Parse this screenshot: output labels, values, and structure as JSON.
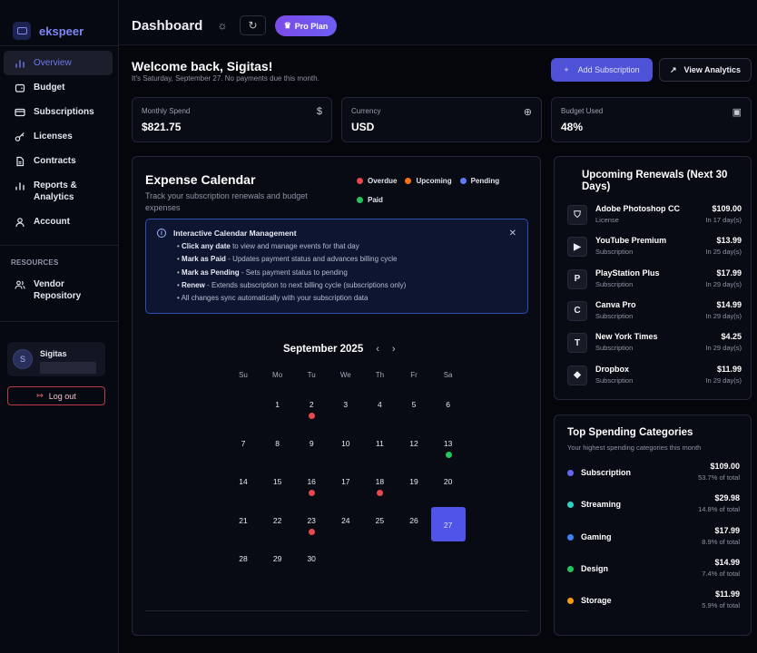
{
  "app": {
    "brand": "ekspeer"
  },
  "sidebar": {
    "items": [
      {
        "label": "Overview"
      },
      {
        "label": "Budget"
      },
      {
        "label": "Subscriptions"
      },
      {
        "label": "Licenses"
      },
      {
        "label": "Contracts"
      },
      {
        "label": "Reports &\nAnalytics"
      },
      {
        "label": "Account"
      }
    ],
    "resources_title": "RESOURCES",
    "resources": [
      {
        "label": "Vendor\nRepository"
      }
    ],
    "user": {
      "initial": "S",
      "name": "Sigitas"
    },
    "logout_label": "Log out"
  },
  "topbar": {
    "title": "Dashboard",
    "pro_label": "Pro Plan"
  },
  "welcome": {
    "title": "Welcome back, Sigitas!",
    "subtitle": "It's Saturday, September 27. No payments due this month.",
    "add_label": "Add Subscription",
    "analytics_label": "View Analytics"
  },
  "stats": [
    {
      "label": "Monthly Spend",
      "value": "$821.75",
      "icon": "dollar-icon"
    },
    {
      "label": "Currency",
      "value": "USD",
      "icon": "globe-icon"
    },
    {
      "label": "Budget Used",
      "value": "48%",
      "icon": "wallet-icon"
    }
  ],
  "calendar": {
    "title": "Expense Calendar",
    "subtitle": "Track your subscription renewals and budget expenses",
    "legend": [
      {
        "label": "Overdue",
        "color": "#e5484d"
      },
      {
        "label": "Upcoming",
        "color": "#f97316"
      },
      {
        "label": "Pending",
        "color": "#5b7cf6"
      },
      {
        "label": "Paid",
        "color": "#22c55e"
      }
    ],
    "info": {
      "title": "Interactive Calendar Management",
      "lines": [
        {
          "bold": "Click any date",
          "text": " to view and manage events for that day"
        },
        {
          "bold": "Mark as Paid",
          "text": " - Updates payment status and advances billing cycle"
        },
        {
          "bold": "Mark as Pending",
          "text": " - Sets payment status to pending"
        },
        {
          "bold": "Renew",
          "text": " - Extends subscription to next billing cycle (subscriptions only)"
        },
        {
          "bold": "",
          "text": "All changes sync automatically with your subscription data"
        }
      ]
    },
    "month_label": "September 2025",
    "weekdays": [
      "Su",
      "Mo",
      "Tu",
      "We",
      "Th",
      "Fr",
      "Sa"
    ],
    "first_weekday": 1,
    "days_in_month": 30,
    "today": 27,
    "events": {
      "2": "#e5484d",
      "13": "#22c55e",
      "16": "#e5484d",
      "18": "#e5484d",
      "23": "#e5484d"
    }
  },
  "renewals": {
    "title": "Upcoming Renewals (Next 30 Days)",
    "items": [
      {
        "name": "Adobe Photoshop CC",
        "type": "License",
        "price": "$109.00",
        "due": "In 17 day(s)",
        "icon": "shield-icon",
        "glyph": "⛉"
      },
      {
        "name": "YouTube Premium",
        "type": "Subscription",
        "price": "$13.99",
        "due": "In 25 day(s)",
        "icon": "youtube-icon",
        "glyph": "▶"
      },
      {
        "name": "PlayStation Plus",
        "type": "Subscription",
        "price": "$17.99",
        "due": "In 29 day(s)",
        "icon": "playstation-icon",
        "glyph": "P"
      },
      {
        "name": "Canva Pro",
        "type": "Subscription",
        "price": "$14.99",
        "due": "In 29 day(s)",
        "icon": "canva-icon",
        "glyph": "C"
      },
      {
        "name": "New York Times",
        "type": "Subscription",
        "price": "$4.25",
        "due": "In 29 day(s)",
        "icon": "nyt-icon",
        "glyph": "T"
      },
      {
        "name": "Dropbox",
        "type": "Subscription",
        "price": "$11.99",
        "due": "In 29 day(s)",
        "icon": "dropbox-icon",
        "glyph": "◆"
      }
    ]
  },
  "categories": {
    "title": "Top Spending Categories",
    "subtitle": "Your highest spending categories this month",
    "items": [
      {
        "name": "Subscription",
        "value": "$109.00",
        "pct": "53.7% of total",
        "color": "#6366f1"
      },
      {
        "name": "Streaming",
        "value": "$29.98",
        "pct": "14.8% of total",
        "color": "#2dd4bf"
      },
      {
        "name": "Gaming",
        "value": "$17.99",
        "pct": "8.9% of total",
        "color": "#3b82f6"
      },
      {
        "name": "Design",
        "value": "$14.99",
        "pct": "7.4% of total",
        "color": "#22c55e"
      },
      {
        "name": "Storage",
        "value": "$11.99",
        "pct": "5.9% of total",
        "color": "#f59e0b"
      }
    ]
  }
}
